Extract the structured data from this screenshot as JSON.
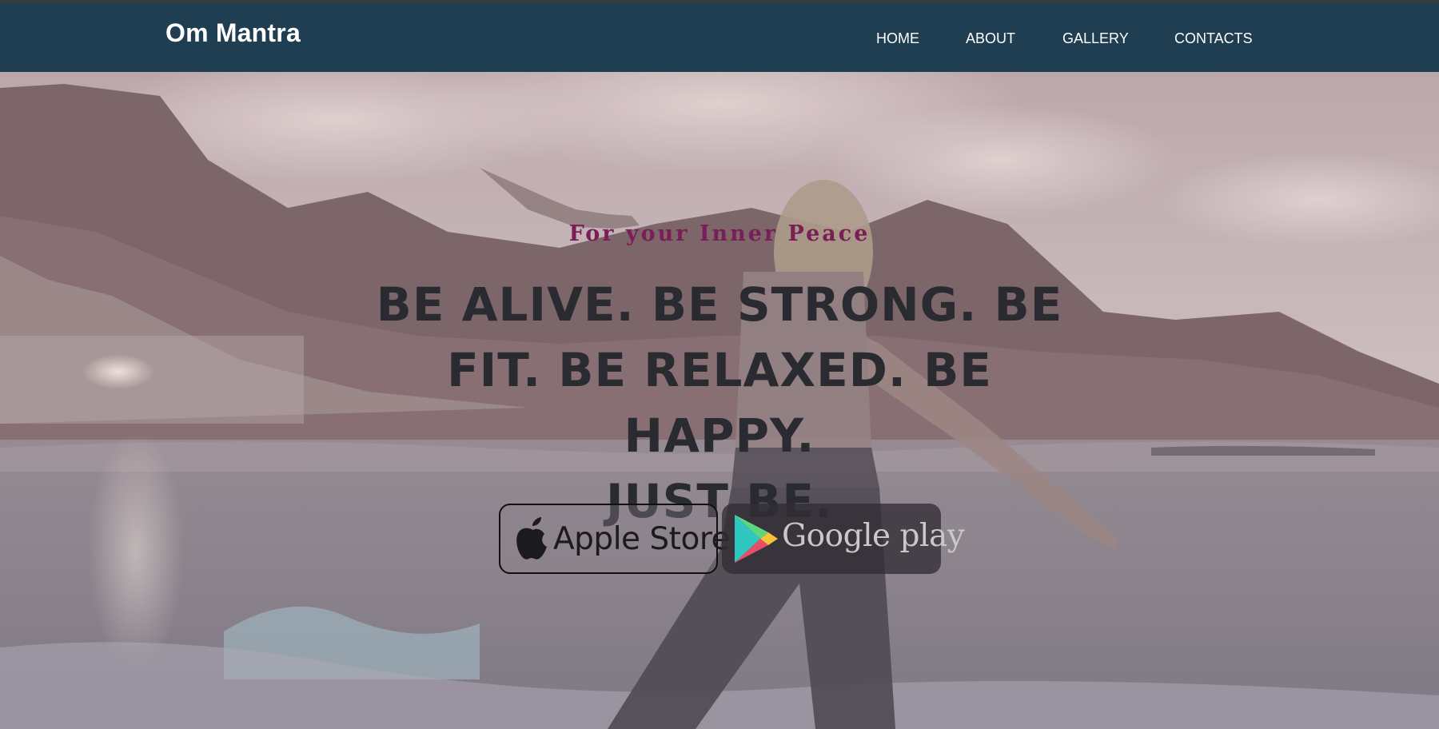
{
  "header": {
    "brand": "Om Mantra",
    "nav": [
      {
        "label": "HOME"
      },
      {
        "label": "ABOUT"
      },
      {
        "label": "GALLERY"
      },
      {
        "label": "CONTACTS"
      }
    ],
    "background_color": "#1f3e52"
  },
  "hero": {
    "subtitle": "For your Inner Peace",
    "headline_lines": [
      "BE ALIVE. BE STRONG. BE",
      "FIT. BE RELAXED. BE HAPPY.",
      "JUST BE."
    ],
    "subtitle_color": "#7a1e58",
    "headline_color": "#2a2b31",
    "background_image": "yoga-woman-on-beach-photo"
  },
  "stores": {
    "apple_label": "Apple Store",
    "google_label": "Google play"
  }
}
